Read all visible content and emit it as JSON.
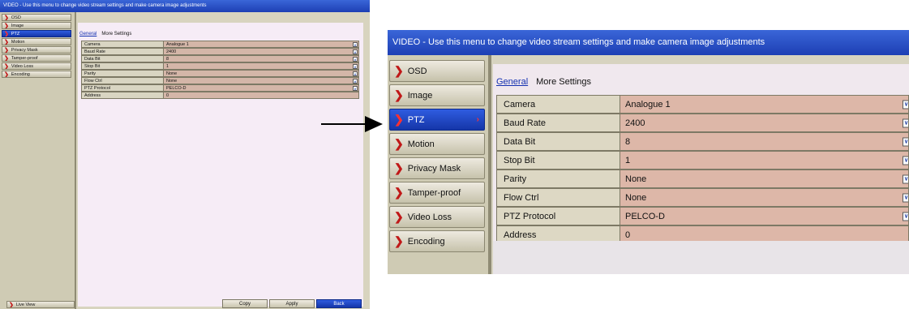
{
  "window_title": "VIDEO - Use this menu to change video stream settings and make camera image adjustments",
  "sidebar": {
    "items": [
      {
        "label": "OSD"
      },
      {
        "label": "Image"
      },
      {
        "label": "PTZ",
        "active": true
      },
      {
        "label": "Motion"
      },
      {
        "label": "Privacy Mask"
      },
      {
        "label": "Tamper-proof"
      },
      {
        "label": "Video Loss"
      },
      {
        "label": "Encoding"
      }
    ],
    "live_view_label": "Live View"
  },
  "tabs": [
    {
      "label": "General",
      "active": true
    },
    {
      "label": "More Settings"
    }
  ],
  "settings": [
    {
      "label": "Camera",
      "value": "Analogue 1",
      "dropdown": true
    },
    {
      "label": "Baud Rate",
      "value": "2400",
      "dropdown": true
    },
    {
      "label": "Data Bit",
      "value": "8",
      "dropdown": true
    },
    {
      "label": "Stop Bit",
      "value": "1",
      "dropdown": true
    },
    {
      "label": "Parity",
      "value": "None",
      "dropdown": true
    },
    {
      "label": "Flow Ctrl",
      "value": "None",
      "dropdown": true
    },
    {
      "label": "PTZ Protocol",
      "value": "PELCO-D",
      "dropdown": true
    },
    {
      "label": "Address",
      "value": "0",
      "dropdown": false
    }
  ],
  "buttons": {
    "copy": "Copy",
    "apply": "Apply",
    "back": "Back"
  },
  "icons": {
    "menu_item_chevron": "chevron-right-icon",
    "dropdown": "chevron-down-icon",
    "annotation": "arrow-right-icon"
  },
  "colors": {
    "title_bar": "#1d3fb4",
    "active_item": "#1536a8",
    "chevron": "#c01818",
    "content_bg": "#f6ecf6",
    "value_cell": "#d4b6a8"
  }
}
